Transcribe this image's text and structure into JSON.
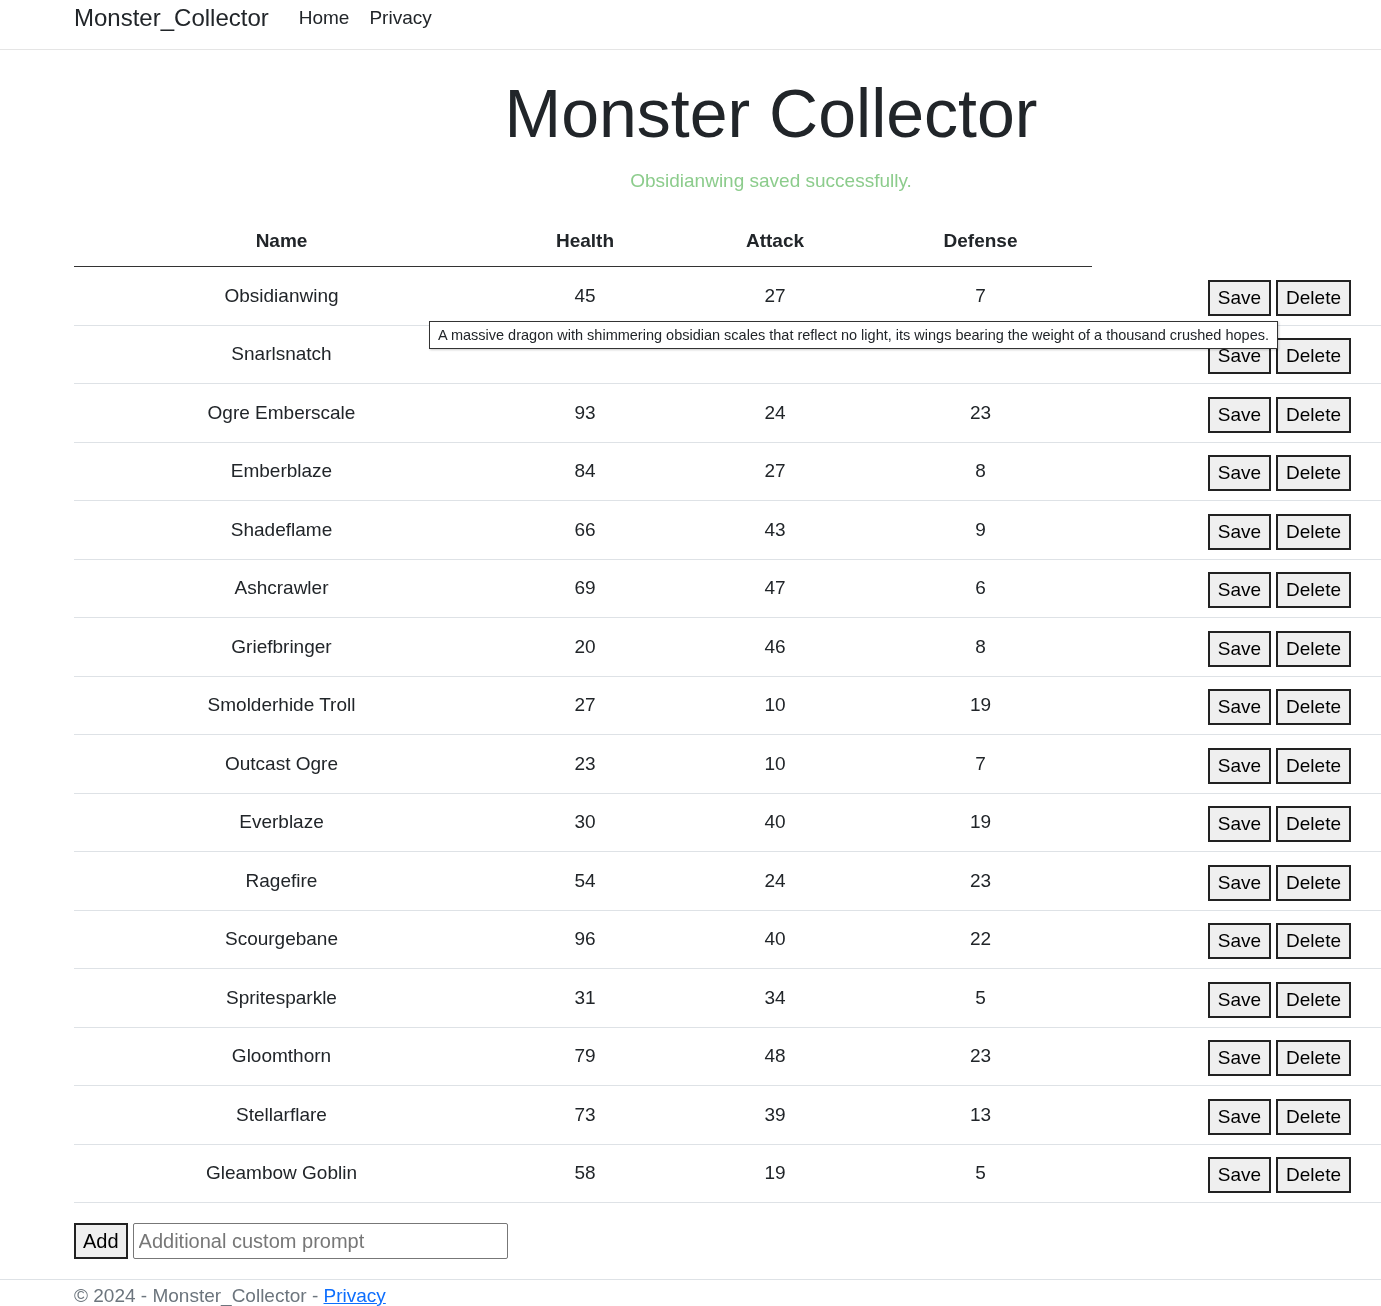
{
  "navbar": {
    "brand": "Monster_Collector",
    "links": [
      "Home",
      "Privacy"
    ]
  },
  "heading": "Monster Collector",
  "message": "Obsidianwing saved successfully.",
  "table": {
    "columns": [
      "Name",
      "Health",
      "Attack",
      "Defense"
    ],
    "rows": [
      {
        "name": "Obsidianwing",
        "health": "45",
        "attack": "27",
        "defense": "7",
        "buttons": [
          "Save",
          "Delete"
        ]
      },
      {
        "name": "Snarlsnatch",
        "buttons": [
          "Save",
          "Delete"
        ]
      },
      {
        "name": "Ogre Emberscale",
        "health": "93",
        "attack": "24",
        "defense": "23",
        "buttons": [
          "Save",
          "Delete"
        ]
      },
      {
        "name": "Emberblaze",
        "health": "84",
        "attack": "27",
        "defense": "8",
        "buttons": [
          "Save",
          "Delete"
        ]
      },
      {
        "name": "Shadeflame",
        "health": "66",
        "attack": "43",
        "defense": "9",
        "buttons": [
          "Save",
          "Delete"
        ]
      },
      {
        "name": "Ashcrawler",
        "health": "69",
        "attack": "47",
        "defense": "6",
        "buttons": [
          "Save",
          "Delete"
        ]
      },
      {
        "name": "Griefbringer",
        "health": "20",
        "attack": "46",
        "defense": "8",
        "buttons": [
          "Save",
          "Delete"
        ]
      },
      {
        "name": "Smolderhide Troll",
        "health": "27",
        "attack": "10",
        "defense": "19",
        "buttons": [
          "Save",
          "Delete"
        ]
      },
      {
        "name": "Outcast Ogre",
        "health": "23",
        "attack": "10",
        "defense": "7",
        "buttons": [
          "Save",
          "Delete"
        ]
      },
      {
        "name": "Everblaze",
        "health": "30",
        "attack": "40",
        "defense": "19",
        "buttons": [
          "Save",
          "Delete"
        ]
      },
      {
        "name": "Ragefire",
        "health": "54",
        "attack": "24",
        "defense": "23",
        "buttons": [
          "Save",
          "Delete"
        ]
      },
      {
        "name": "Scourgebane",
        "health": "96",
        "attack": "40",
        "defense": "22",
        "buttons": [
          "Save",
          "Delete"
        ]
      },
      {
        "name": "Spritesparkle",
        "health": "31",
        "attack": "34",
        "defense": "5",
        "buttons": [
          "Save",
          "Delete"
        ]
      },
      {
        "name": "Gloomthorn",
        "health": "79",
        "attack": "48",
        "defense": "23",
        "buttons": [
          "Save",
          "Delete"
        ]
      },
      {
        "name": "Stellarflare",
        "health": "73",
        "attack": "39",
        "defense": "13",
        "buttons": [
          "Save",
          "Delete"
        ]
      },
      {
        "name": "Gleambow Goblin",
        "health": "58",
        "attack": "19",
        "defense": "5",
        "buttons": [
          "Save",
          "Delete"
        ]
      }
    ],
    "tooltip": "A massive dragon with shimmering obsidian scales that reflect no light, its wings bearing the weight of a thousand crushed hopes."
  },
  "add_form": {
    "button": "Add",
    "placeholder": "Additional custom prompt"
  },
  "footer": {
    "text": "© 2024 - Monster_Collector - ",
    "link": "Privacy"
  }
}
